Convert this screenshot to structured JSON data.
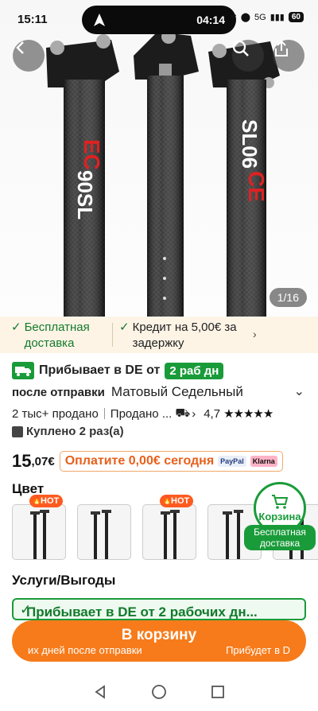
{
  "status_bar": {
    "time": "15:11",
    "island_time": "04:14",
    "network": "5G",
    "battery": "60"
  },
  "hero": {
    "counter": "1/16",
    "brand_text": "EC90SL",
    "icons": [
      "back-icon",
      "search-icon",
      "share-icon"
    ]
  },
  "benefits": {
    "free_shipping": "Бесплатная доставка",
    "credit": "Кредит на 5,00€ за задержку"
  },
  "delivery": {
    "arrives_label": "Прибывает в DE от",
    "badge": "2 раб дн",
    "after_label": "после отправки",
    "product_title": "Матовый Седельный"
  },
  "stats": {
    "sold": "2 тыс+ продано",
    "sold_by": "Продано ...",
    "rating": "4,7",
    "stars": "★★★★★"
  },
  "bought": "Куплено 2 раз(а)",
  "price": {
    "integer": "15",
    "fraction": ",07€",
    "pay_today": "Оплатите 0,00€ сегодня",
    "paypal": "PayPal",
    "klarna": "Klarna"
  },
  "color": {
    "label": "Цвет",
    "hot_label": "HOT"
  },
  "cart_widget": {
    "label": "Корзина",
    "shipping": "Бесплатная доставка"
  },
  "services": {
    "label": "Услуги/Выгоды",
    "arrival_banner": "Прибывает в DE от 2 рабочих дн..."
  },
  "add_to_cart": {
    "label": "В корзину",
    "sub_left": "их дней после отправки",
    "sub_right": "Прибудет в D"
  },
  "colors": {
    "accent_orange": "#f77b1b",
    "green": "#1a9b3a"
  }
}
